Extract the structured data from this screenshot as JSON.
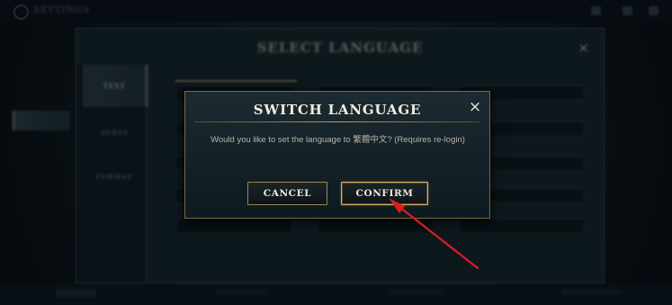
{
  "window": {
    "title": "SETTINGS"
  },
  "settings_panel": {
    "title": "SELECT LANGUAGE",
    "close_icon": "close-icon",
    "tabs": [
      {
        "label": "TEXT",
        "active": true
      },
      {
        "label": "AUDIO",
        "active": false
      },
      {
        "label": "FORMAT",
        "active": false
      }
    ]
  },
  "dialog": {
    "title": "SWITCH LANGUAGE",
    "close_icon": "close-icon",
    "message": "Would you like to set the language to 繁體中文? (Requires re-login)",
    "buttons": {
      "cancel": "CANCEL",
      "confirm": "CONFIRM"
    }
  },
  "annotation": {
    "type": "arrow",
    "color": "#d91f1f",
    "target": "confirm-button"
  },
  "colors": {
    "accent_gold": "#c8a45d",
    "dialog_background": "#13232a",
    "title_text": "#f1ede0",
    "body_text": "#b7b3a6"
  }
}
